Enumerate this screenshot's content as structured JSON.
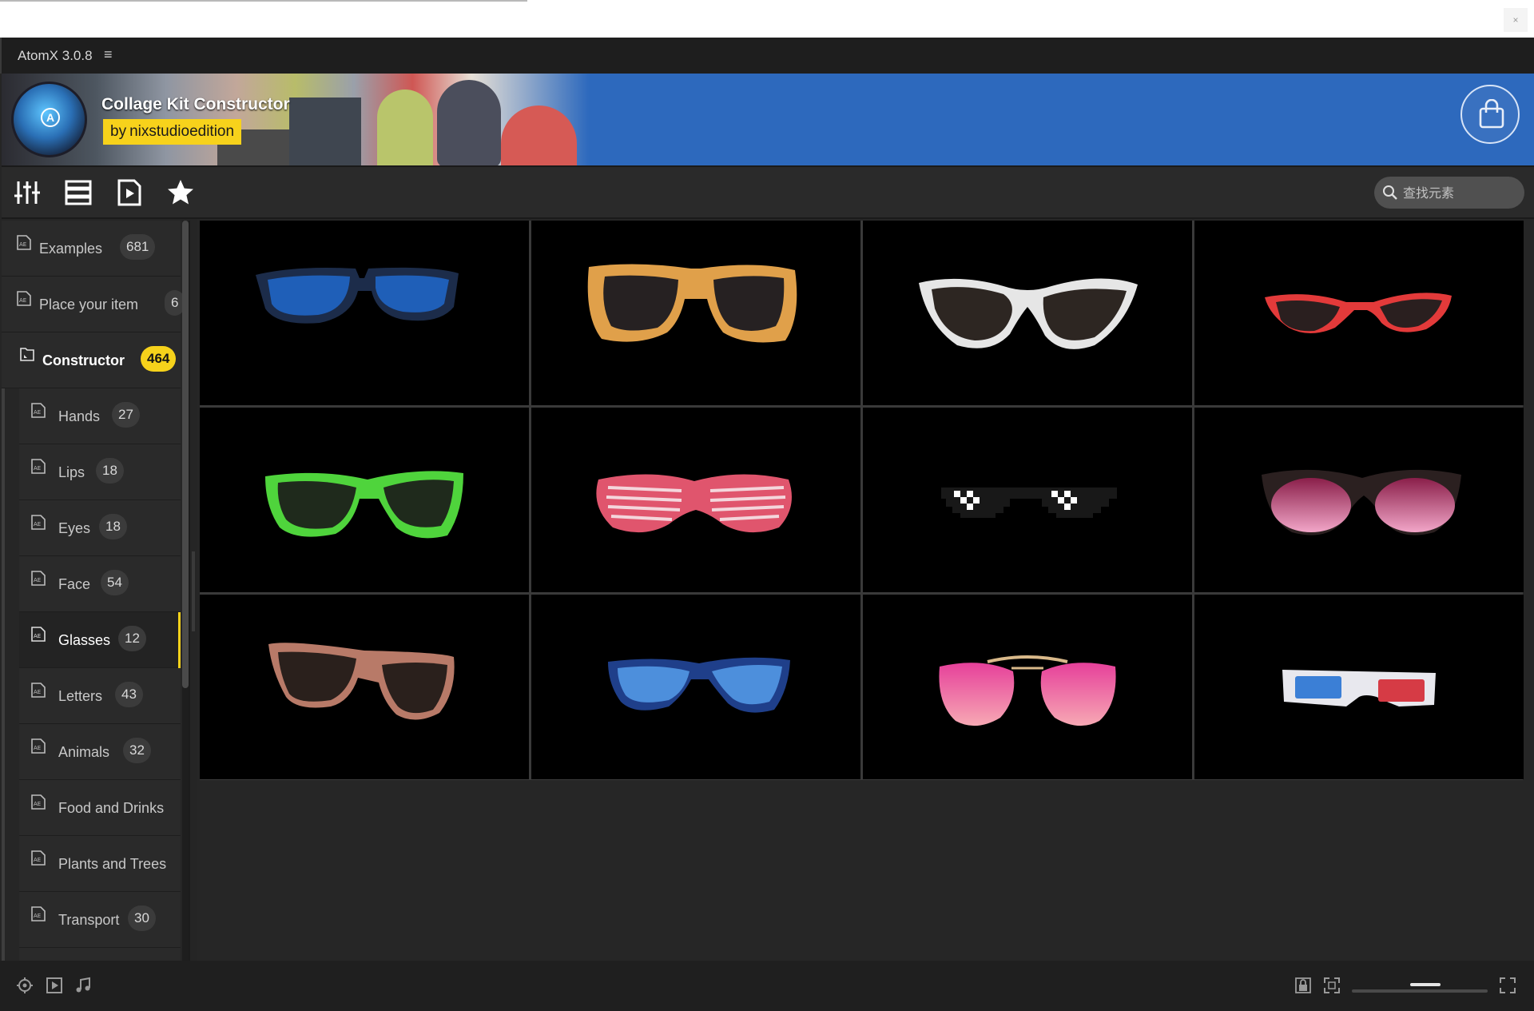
{
  "os_bar": {
    "close_glyph": "×"
  },
  "app": {
    "title": "AtomX 3.0.8",
    "menu_glyph": "≡"
  },
  "banner": {
    "title": "Collage Kit Constructor",
    "author_prefix": "by",
    "author": "nixstudioedition",
    "cart_icon": "shopping-bag-icon"
  },
  "toolbar": {
    "icons": [
      "sliders-icon",
      "list-view-icon",
      "video-file-icon",
      "favorites-star-icon"
    ],
    "search": {
      "placeholder": "查找元素",
      "value": ""
    }
  },
  "sidebar": {
    "items": [
      {
        "label": "Examples",
        "count": "681",
        "level": 0,
        "active": false
      },
      {
        "label": "Place your item",
        "count": "6",
        "level": 0,
        "active": false
      },
      {
        "label": "Constructor",
        "count": "464",
        "level": 0,
        "active": false,
        "bold": true
      },
      {
        "label": "Hands",
        "count": "27",
        "level": 1,
        "active": false
      },
      {
        "label": "Lips",
        "count": "18",
        "level": 1,
        "active": false
      },
      {
        "label": "Eyes",
        "count": "18",
        "level": 1,
        "active": false
      },
      {
        "label": "Face",
        "count": "54",
        "level": 1,
        "active": false
      },
      {
        "label": "Glasses",
        "count": "12",
        "level": 1,
        "active": true
      },
      {
        "label": "Letters",
        "count": "43",
        "level": 1,
        "active": false
      },
      {
        "label": "Animals",
        "count": "32",
        "level": 1,
        "active": false
      },
      {
        "label": "Food and Drinks",
        "count": "",
        "level": 1,
        "active": false
      },
      {
        "label": "Plants and Trees",
        "count": "",
        "level": 1,
        "active": false
      },
      {
        "label": "Transport",
        "count": "30",
        "level": 1,
        "active": false
      }
    ]
  },
  "grid": {
    "items": [
      {
        "name": "blue-wayfarer-sunglasses"
      },
      {
        "name": "orange-frame-sunglasses"
      },
      {
        "name": "white-cat-eye-sunglasses"
      },
      {
        "name": "red-cat-eye-sunglasses"
      },
      {
        "name": "green-wayfarer-sunglasses"
      },
      {
        "name": "pink-shutter-shades"
      },
      {
        "name": "pixel-deal-with-it-glasses"
      },
      {
        "name": "pink-gradient-round-sunglasses"
      },
      {
        "name": "brown-wayfarer-sunglasses"
      },
      {
        "name": "blue-lens-sunglasses"
      },
      {
        "name": "pink-aviator-sunglasses"
      },
      {
        "name": "red-blue-3d-glasses"
      }
    ]
  },
  "bottom_bar": {
    "left_icons": [
      "target-icon",
      "play-preview-icon",
      "music-note-icon"
    ],
    "right_icons": [
      "lock-icon",
      "fit-screen-icon",
      "fullscreen-icon"
    ],
    "zoom_level": 0.55
  },
  "colors": {
    "accent": "#f6d21b",
    "banner_blue": "#2d69bd",
    "background": "#262626"
  }
}
